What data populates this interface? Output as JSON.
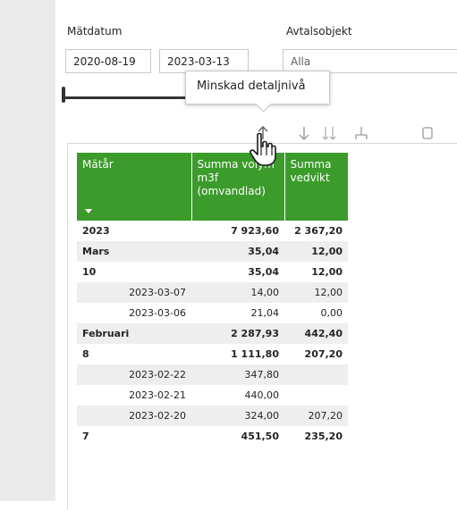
{
  "filters": {
    "date_label": "Mätdatum",
    "date_from": "2020-08-19",
    "date_to": "2023-03-13",
    "object_label": "Avtalsobjekt",
    "object_value": "Alla"
  },
  "tooltip": {
    "text": "Minskad detaljnivå"
  },
  "toolbar": {
    "icons": [
      "arrow-up-icon",
      "arrow-down-icon",
      "double-arrow-down-icon",
      "expand-hierarchy-icon",
      "focus-mode-icon"
    ]
  },
  "matrix": {
    "header_color": "#3b9b2b",
    "columns": [
      "Mätår",
      "Summa volym m3f (omvandlad)",
      "Summa vedvikt"
    ],
    "rows": [
      {
        "label": "2023",
        "level": 0,
        "bold": true,
        "v1": "7 923,60",
        "v2": "2 367,20"
      },
      {
        "label": "Mars",
        "level": 1,
        "bold": true,
        "v1": "35,04",
        "v2": "12,00"
      },
      {
        "label": "10",
        "level": 2,
        "bold": true,
        "v1": "35,04",
        "v2": "12,00"
      },
      {
        "label": "2023-03-07",
        "level": 3,
        "bold": false,
        "v1": "14,00",
        "v2": "12,00"
      },
      {
        "label": "2023-03-06",
        "level": 3,
        "bold": false,
        "v1": "21,04",
        "v2": "0,00"
      },
      {
        "label": "Februari",
        "level": 1,
        "bold": true,
        "v1": "2 287,93",
        "v2": "442,40"
      },
      {
        "label": "8",
        "level": 2,
        "bold": true,
        "v1": "1 111,80",
        "v2": "207,20"
      },
      {
        "label": "2023-02-22",
        "level": 3,
        "bold": false,
        "v1": "347,80",
        "v2": ""
      },
      {
        "label": "2023-02-21",
        "level": 3,
        "bold": false,
        "v1": "440,00",
        "v2": ""
      },
      {
        "label": "2023-02-20",
        "level": 3,
        "bold": false,
        "v1": "324,00",
        "v2": "207,20"
      },
      {
        "label": "7",
        "level": 2,
        "bold": true,
        "v1": "451,50",
        "v2": "235,20"
      }
    ]
  }
}
